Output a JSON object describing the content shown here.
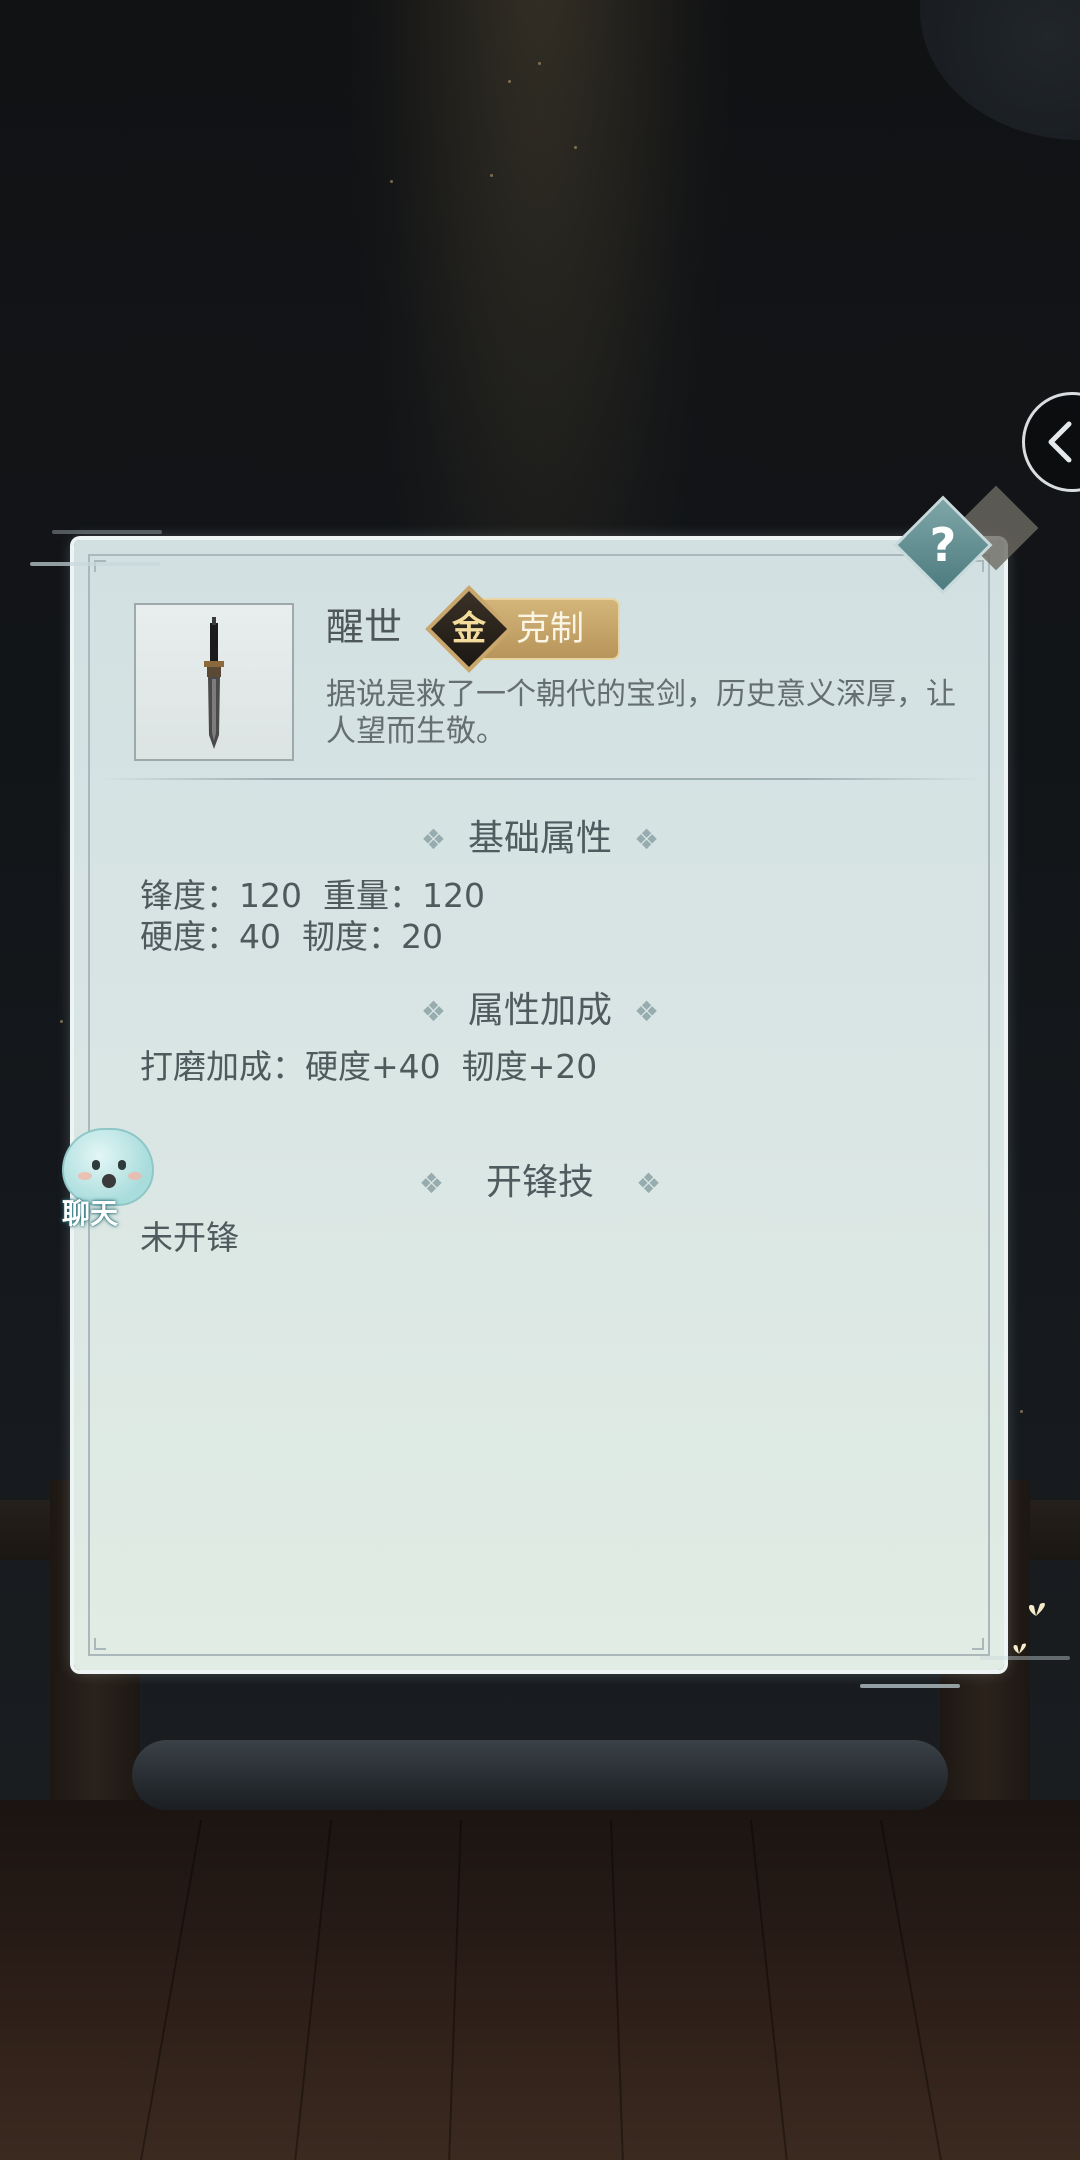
{
  "item": {
    "name": "醒世",
    "badge_glyph": "金",
    "badge_label": "克制",
    "description": "据说是救了一个朝代的宝剑，历史意义深厚，让人望而生敬。"
  },
  "sections": {
    "base_attributes": {
      "title": "基础属性",
      "lines": [
        "锋度：120  重量：120",
        "硬度：40  韧度：20"
      ]
    },
    "attribute_bonus": {
      "title": "属性加成",
      "lines": [
        "打磨加成：硬度+40  韧度+20"
      ]
    },
    "sharpen_skill": {
      "title": "开锋技",
      "lines": [
        "未开锋"
      ]
    }
  },
  "help_button": {
    "label": "?"
  },
  "chat_widget": {
    "label": "聊天"
  },
  "colors": {
    "panel_bg": "#d8e4e3",
    "badge_gold": "#c9a66b",
    "text_main": "#4f5a5d",
    "help_teal": "#5f8f92"
  },
  "icons": {
    "back": "chevron-left-icon",
    "help": "question-icon",
    "sword": "sword-icon",
    "element": "gold-element-icon",
    "chat": "ghost-chat-icon"
  }
}
